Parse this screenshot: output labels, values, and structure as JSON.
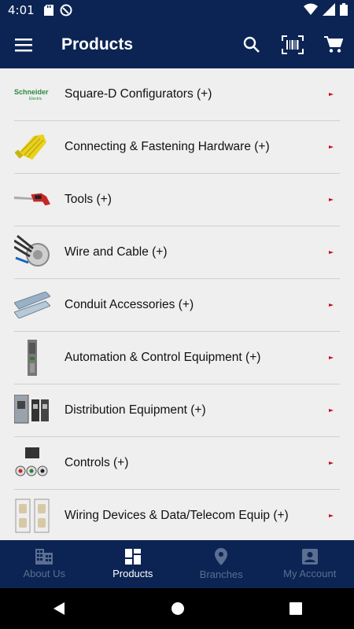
{
  "status": {
    "time": "4:01"
  },
  "appbar": {
    "title": "Products",
    "menu_icon": "menu-icon",
    "search_icon": "search-icon",
    "scan_icon": "barcode-scan-icon",
    "cart_icon": "cart-icon"
  },
  "colors": {
    "primary": "#0b2453",
    "nav_inactive": "#5c6e92",
    "chevron": "#c0111a"
  },
  "products": [
    {
      "label": "Square-D Configurators (+)",
      "thumb": "schneider-logo"
    },
    {
      "label": "Connecting & Fastening Hardware (+)",
      "thumb": "wire-nut-icon"
    },
    {
      "label": "Tools (+)",
      "thumb": "saw-icon"
    },
    {
      "label": "Wire and Cable (+)",
      "thumb": "cable-icon"
    },
    {
      "label": "Conduit Accessories (+)",
      "thumb": "conduit-icon"
    },
    {
      "label": "Automation & Control Equipment (+)",
      "thumb": "control-module-icon"
    },
    {
      "label": "Distribution Equipment (+)",
      "thumb": "panel-icon"
    },
    {
      "label": "Controls (+)",
      "thumb": "relay-icon"
    },
    {
      "label": "Wiring Devices & Data/Telecom Equip (+)",
      "thumb": "receptacle-icon"
    }
  ],
  "schneider": {
    "brand": "Schneider",
    "sub": "Electric"
  },
  "nav": [
    {
      "label": "About Us",
      "icon": "building-icon",
      "active": false
    },
    {
      "label": "Products",
      "icon": "grid-icon",
      "active": true
    },
    {
      "label": "Branches",
      "icon": "location-pin-icon",
      "active": false
    },
    {
      "label": "My Account",
      "icon": "account-icon",
      "active": false
    }
  ]
}
